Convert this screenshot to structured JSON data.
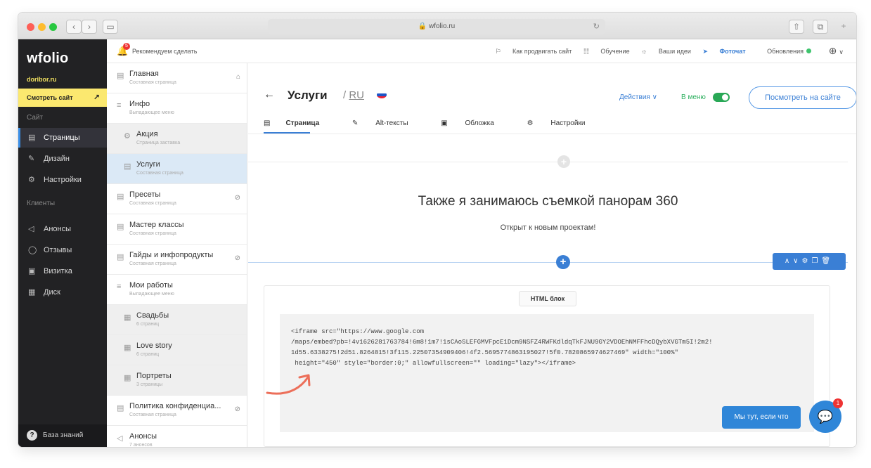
{
  "browser": {
    "url": "wfolio.ru",
    "back_glyph": "‹",
    "forward_glyph": "›",
    "sidebar_glyph": "▭",
    "reload_glyph": "↻",
    "share_glyph": "⇧",
    "tabs_glyph": "⧉",
    "newtab_glyph": "+"
  },
  "sidebar": {
    "logo": "wfolio",
    "domain": "doribor.ru",
    "view_site": "Смотреть сайт",
    "view_site_icon": "external-link-icon",
    "section_site": "Сайт",
    "site_items": [
      {
        "label": "Страницы",
        "icon": "page-icon",
        "active": true
      },
      {
        "label": "Дизайн",
        "icon": "brush-icon",
        "active": false
      },
      {
        "label": "Настройки",
        "icon": "gear-icon",
        "active": false
      }
    ],
    "section_clients": "Клиенты",
    "client_items": [
      {
        "label": "Анонсы",
        "icon": "megaphone-icon"
      },
      {
        "label": "Отзывы",
        "icon": "chat-icon"
      },
      {
        "label": "Визитка",
        "icon": "card-icon"
      },
      {
        "label": "Диск",
        "icon": "database-icon"
      }
    ],
    "knowledge_base": "База знаний"
  },
  "topbar": {
    "notif_count": "5",
    "recommend": "Рекомендуем сделать",
    "promote": "Как продвигать сайт",
    "learning": "Обучение",
    "ideas": "Ваши идеи",
    "fotochat": "Фоточат",
    "updates": "Обновления",
    "update_status_color": "#3ec46d"
  },
  "pages": [
    {
      "title": "Главная",
      "subtitle": "Составная страница",
      "type": "page",
      "right_icon": "⌂"
    },
    {
      "title": "Инфо",
      "subtitle": "Выпадающее меню",
      "type": "menu"
    },
    {
      "title": "Акция",
      "subtitle": "Страница заставка",
      "type": "sub"
    },
    {
      "title": "Услуги",
      "subtitle": "Составная страница",
      "type": "sub",
      "selected": true
    },
    {
      "title": "Пресеты",
      "subtitle": "Составная страница",
      "type": "page",
      "right_icon": "⊘"
    },
    {
      "title": "Мастер классы",
      "subtitle": "Составная страница",
      "type": "page"
    },
    {
      "title": "Гайды и инфопродукты",
      "subtitle": "Составная страница",
      "type": "page",
      "right_icon": "⊘"
    },
    {
      "title": "Мои работы",
      "subtitle": "Выпадающее меню",
      "type": "menu"
    },
    {
      "title": "Свадьбы",
      "subtitle": "6 страниц",
      "type": "sub-grid"
    },
    {
      "title": "Love story",
      "subtitle": "6 страниц",
      "type": "sub-grid"
    },
    {
      "title": "Портреты",
      "subtitle": "3 страницы",
      "type": "sub-grid"
    },
    {
      "title": "Политика конфиденциа...",
      "subtitle": "Составная страница",
      "type": "page",
      "right_icon": "⊘"
    },
    {
      "title": "Анонсы",
      "subtitle": "7 анонсов",
      "type": "announce"
    }
  ],
  "editor": {
    "back": "←",
    "title": "Услуги",
    "lang": "RU",
    "actions": "Действия ∨",
    "in_menu": "В меню",
    "view_on_site": "Посмотреть на сайте",
    "tabs": [
      "Страница",
      "Alt-тексты",
      "Обложка",
      "Настройки"
    ],
    "tab_icons": [
      "▤",
      "✎",
      "▣",
      "⚙"
    ],
    "heading": "Также я занимаюсь съемкой панорам 360",
    "subheading": "Открыт к новым проектам!",
    "block_tools": "∧∨⚙❐🗑",
    "html_block_label": "HTML блок",
    "code": "<iframe src=\"https://www.google.com\n/maps/embed?pb=!4v1626281763784!6m8!1m7!1sCAoSLEFGMVFpcE1Dcm9NSFZ4RWFKdldqTkFJNU9GY2VDOEhNMFFhcDQybXVGTm5I!2m2!\n1d55.6338275!2d51.8264815!3f115.22507354909406!4f2.5695774863195027!5f0.7820865974627469\" width=\"100%\"\n height=\"450\" style=\"border:0;\" allowfullscreen=\"\" loading=\"lazy\"></iframe>",
    "chat_button": "Мы тут, если что",
    "chat_badge": "1"
  }
}
